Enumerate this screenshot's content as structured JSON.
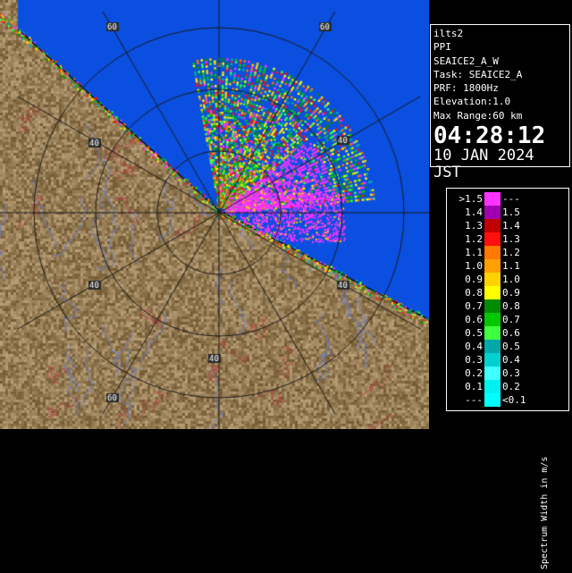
{
  "info": {
    "station": "ilts2",
    "scan_type": "PPI",
    "scan_name": "SEAICE2_A_W",
    "task": "Task: SEAICE2_A",
    "prf": "PRF: 1800Hz",
    "elevation": "Elevation:1.0",
    "max_range": "Max Range:60 km",
    "time": "04:28:12",
    "date": "10 JAN 2024 JST"
  },
  "radar": {
    "range_ring_labels": [
      "40",
      "40",
      "40",
      "40",
      "60",
      "60",
      "60"
    ],
    "colors": {
      "background_sea": "#0a4fe0",
      "terrain": "#7a6545",
      "range_ring": "#1a1a1a",
      "rivers": "#6a7ec8",
      "boundaries": "#b04848"
    }
  },
  "legend": {
    "title": "Spectrum Width in m/s",
    "rows": [
      {
        "low": ">1.5",
        "high": "---",
        "color": "#ff33ff"
      },
      {
        "low": "1.4",
        "high": "1.5",
        "color": "#a000b0"
      },
      {
        "low": "1.3",
        "high": "1.4",
        "color": "#c00000"
      },
      {
        "low": "1.2",
        "high": "1.3",
        "color": "#ff1010"
      },
      {
        "low": "1.1",
        "high": "1.2",
        "color": "#ff7800"
      },
      {
        "low": "1.0",
        "high": "1.1",
        "color": "#ffa000"
      },
      {
        "low": "0.9",
        "high": "1.0",
        "color": "#ffd200"
      },
      {
        "low": "0.8",
        "high": "0.9",
        "color": "#ffff00"
      },
      {
        "low": "0.7",
        "high": "0.8",
        "color": "#008c00"
      },
      {
        "low": "0.6",
        "high": "0.7",
        "color": "#00c800"
      },
      {
        "low": "0.5",
        "high": "0.6",
        "color": "#40ff40"
      },
      {
        "low": "0.4",
        "high": "0.5",
        "color": "#00a8a8"
      },
      {
        "low": "0.3",
        "high": "0.4",
        "color": "#00d0d0"
      },
      {
        "low": "0.2",
        "high": "0.3",
        "color": "#40ffff"
      },
      {
        "low": "0.1",
        "high": "0.2",
        "color": "#00f0f0"
      },
      {
        "low": "---",
        "high": "<0.1",
        "color": "#00ffff"
      }
    ]
  }
}
